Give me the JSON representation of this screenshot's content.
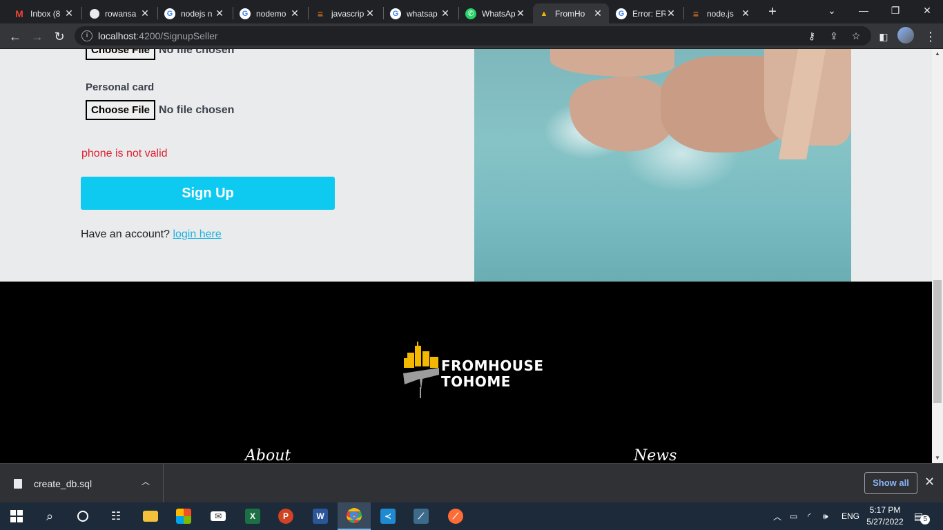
{
  "browser": {
    "tabs": [
      {
        "title": "Inbox (8",
        "favicon": "gmail-icon",
        "active": false
      },
      {
        "title": "rowansa",
        "favicon": "github-icon",
        "active": false
      },
      {
        "title": "nodejs n",
        "favicon": "google-icon",
        "active": false
      },
      {
        "title": "nodemo",
        "favicon": "google-icon",
        "active": false
      },
      {
        "title": "javascrip",
        "favicon": "stackoverflow-icon",
        "active": false
      },
      {
        "title": "whatsap",
        "favicon": "google-icon",
        "active": false
      },
      {
        "title": "WhatsAp",
        "favicon": "whatsapp-icon",
        "active": false
      },
      {
        "title": "FromHo",
        "favicon": "fromhouse-icon",
        "active": true
      },
      {
        "title": "Error: ER",
        "favicon": "google-icon",
        "active": false
      },
      {
        "title": "node.js",
        "favicon": "stackoverflow-icon",
        "active": false
      }
    ],
    "url_host": "localhost",
    "url_path": ":4200/SignupSeller"
  },
  "form": {
    "file_button_label": "Choose File",
    "file_status": "No file chosen",
    "personal_card_label": "Personal card",
    "error_message": "phone is not valid",
    "signup_label": "Sign Up",
    "account_prompt": "Have an account?",
    "login_link": "login here"
  },
  "footer": {
    "brand_line1": "FROMHOUSE",
    "brand_line2": "TOHOME",
    "nav_about": "About",
    "nav_news": "News"
  },
  "downloads": {
    "file_name": "create_db.sql",
    "show_all": "Show all"
  },
  "taskbar": {
    "language": "ENG",
    "time": "5:17 PM",
    "date": "5/27/2022",
    "notification_count": "5"
  },
  "colors": {
    "accent": "#0fcaf0",
    "error": "#e11d2e",
    "link": "#1fb3e0"
  }
}
